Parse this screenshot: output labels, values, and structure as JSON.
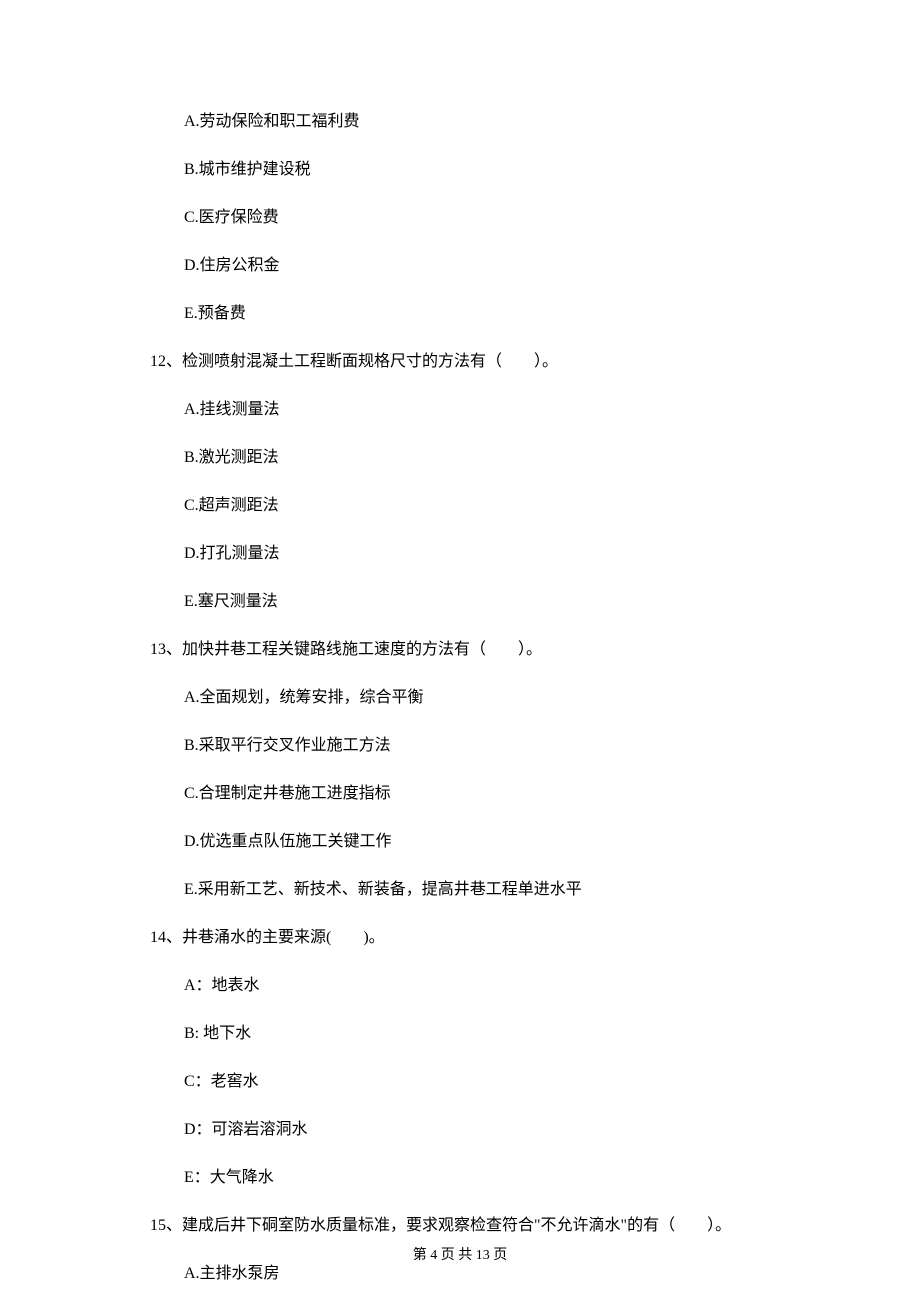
{
  "q11_options": {
    "a": "A.劳动保险和职工福利费",
    "b": "B.城市维护建设税",
    "c": "C.医疗保险费",
    "d": "D.住房公积金",
    "e": "E.预备费"
  },
  "q12": {
    "stem": "12、检测喷射混凝土工程断面规格尺寸的方法有（　　）。",
    "a": "A.挂线测量法",
    "b": "B.激光测距法",
    "c": "C.超声测距法",
    "d": "D.打孔测量法",
    "e": "E.塞尺测量法"
  },
  "q13": {
    "stem": "13、加快井巷工程关键路线施工速度的方法有（　　）。",
    "a": "A.全面规划，统筹安排，综合平衡",
    "b": "B.采取平行交叉作业施工方法",
    "c": "C.合理制定井巷施工进度指标",
    "d": "D.优选重点队伍施工关键工作",
    "e": "E.采用新工艺、新技术、新装备，提高井巷工程单进水平"
  },
  "q14": {
    "stem": "14、井巷涌水的主要来源(　　)。",
    "a": "A：地表水",
    "b": "B:  地下水",
    "c": "C：老窖水",
    "d": "D：可溶岩溶洞水",
    "e": "E：大气降水"
  },
  "q15": {
    "stem": "15、建成后井下硐室防水质量标准，要求观察检查符合\"不允许滴水\"的有（　　）。",
    "a": "A.主排水泵房"
  },
  "footer": "第 4 页 共 13 页"
}
